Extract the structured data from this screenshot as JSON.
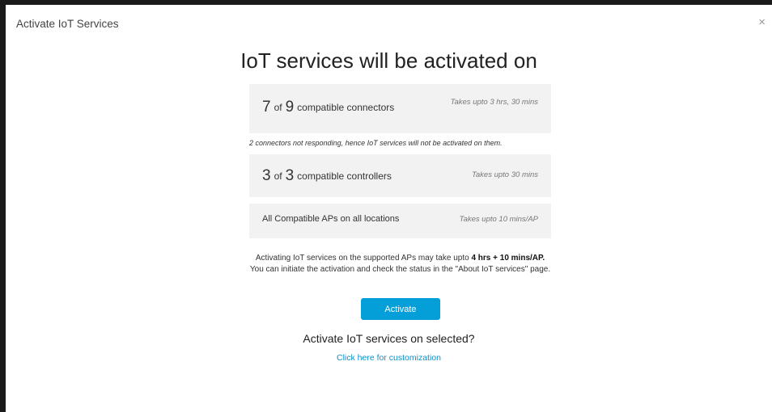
{
  "modal": {
    "title": "Activate IoT Services",
    "close_glyph": "×",
    "heading": "IoT services will be activated on"
  },
  "connectors": {
    "count": "7",
    "of": "of",
    "total": "9",
    "label": "compatible connectors",
    "time": "Takes upto 3 hrs, 30 mins",
    "note": "2 connectors not responding, hence IoT services will not be activated on them."
  },
  "controllers": {
    "count": "3",
    "of": "of",
    "total": "3",
    "label": "compatible controllers",
    "time": "Takes upto 30 mins"
  },
  "aps": {
    "label": "All Compatible APs on all locations",
    "time": "Takes upto 10 mins/AP"
  },
  "info": {
    "prefix": "Activating IoT services on the supported APs may take upto ",
    "bold": "4 hrs + 10 mins/AP.",
    "suffix": " You can initiate the activation and check the status in the \"About IoT services\" page."
  },
  "actions": {
    "activate_label": "Activate",
    "question": "Activate IoT services on selected?",
    "customize_link": "Click here for customization"
  },
  "icons": {
    "close": "close-icon"
  },
  "colors": {
    "primary_button": "#049fd9",
    "link": "#0d8fc8",
    "card_background": "#f2f2f2"
  }
}
